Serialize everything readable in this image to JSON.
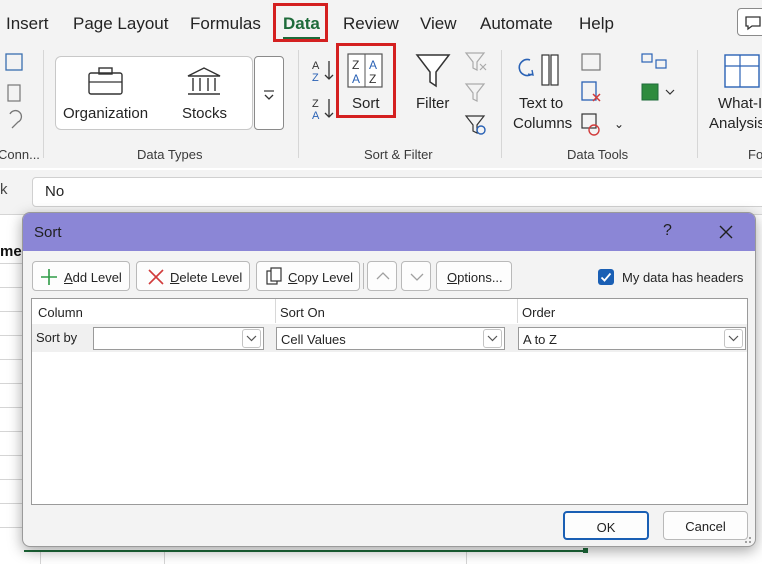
{
  "menu": {
    "items": [
      "Insert",
      "Page Layout",
      "Formulas",
      "Data",
      "Review",
      "View",
      "Automate",
      "Help"
    ],
    "active": "Data"
  },
  "ribbon": {
    "get_data": {
      "label": "Conn..."
    },
    "data_types": {
      "group_label": "Data Types",
      "organization": "Organization",
      "stocks": "Stocks"
    },
    "sort_filter": {
      "group_label": "Sort & Filter",
      "sort": "Sort",
      "filter": "Filter"
    },
    "data_tools": {
      "group_label": "Data Tools",
      "text_to_columns_line1": "Text to",
      "text_to_columns_line2": "Columns"
    },
    "forecast": {
      "what_if_line1": "What-I",
      "what_if_line2": "Analysis",
      "group_label": "Fo"
    }
  },
  "formula_bar": {
    "name_box_fragment": "k",
    "value": "No"
  },
  "sheet": {
    "header_fragment": "me"
  },
  "dialog": {
    "title": "Sort",
    "help": "?",
    "toolbar": {
      "add_level": "Add Level",
      "delete_level": "Delete Level",
      "copy_level": "Copy Level",
      "options": "Options..."
    },
    "headers_checkbox": {
      "label": "My data has headers",
      "checked": true
    },
    "columns": {
      "column": "Column",
      "sort_on": "Sort On",
      "order": "Order"
    },
    "row": {
      "label": "Sort by",
      "column_value": "",
      "sort_on_value": "Cell Values",
      "order_value": "A to Z"
    },
    "ok": "OK",
    "cancel": "Cancel"
  },
  "colors": {
    "accent_green": "#1e6b3a",
    "highlight_red": "#d42020",
    "dialog_title": "#8b86d6",
    "primary_blue": "#1a5fb4"
  }
}
